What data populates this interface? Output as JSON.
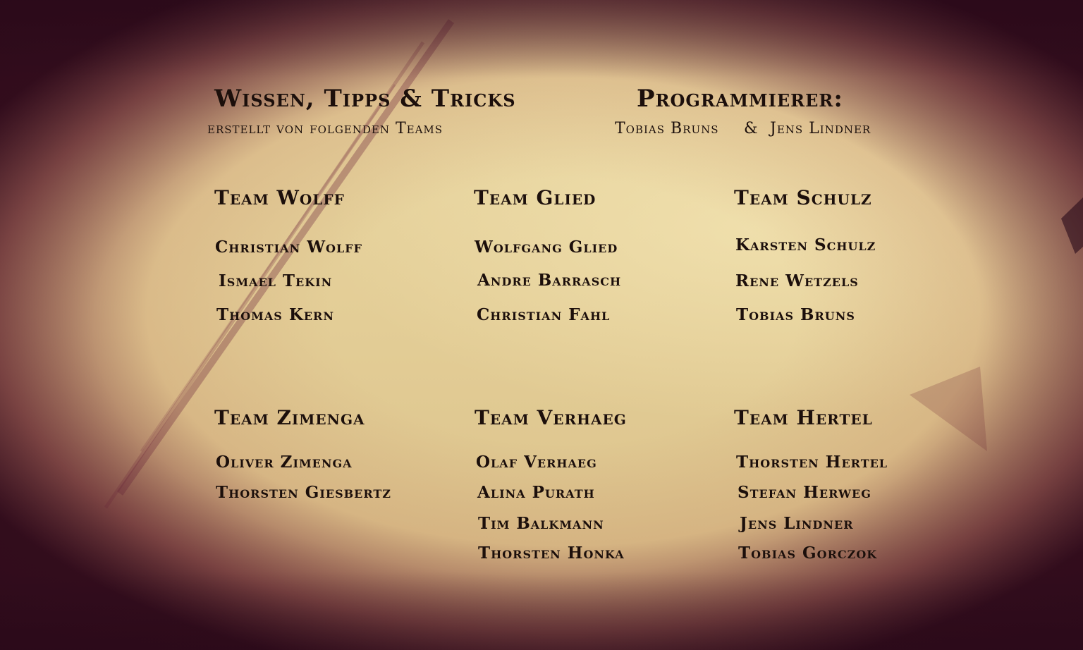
{
  "header": {
    "left_title": "Wissen, Tipps & Tricks",
    "left_subtitle": "erstellt von folgenden Teams",
    "right_title": "Programmierer:",
    "programmer_1": "Tobias Bruns",
    "ampersand": "&",
    "programmer_2": "Jens Lindner"
  },
  "teams": [
    {
      "name": "Team Wolff",
      "members": [
        "Christian Wolff",
        "Ismael Tekin",
        "Thomas Kern"
      ]
    },
    {
      "name": "Team Glied",
      "members": [
        "Wolfgang Glied",
        "Andre Barrasch",
        "Christian Fahl"
      ]
    },
    {
      "name": "Team Schulz",
      "members": [
        "Karsten Schulz",
        "Rene Wetzels",
        "Tobias Bruns"
      ]
    },
    {
      "name": "Team Zimenga",
      "members": [
        "Oliver Zimenga",
        "Thorsten Giesbertz"
      ]
    },
    {
      "name": "Team Verhaeg",
      "members": [
        "Olaf Verhaeg",
        "Alina Purath",
        "Tim Balkmann",
        "Thorsten Honka"
      ]
    },
    {
      "name": "Team Hertel",
      "members": [
        "Thorsten Hertel",
        "Stefan Herweg",
        "Jens Lindner",
        "Tobias Gorczok"
      ]
    }
  ],
  "colors": {
    "text": "#1c0f0b",
    "parchment": "#e9d7a2",
    "edge": "#3a0f24"
  }
}
